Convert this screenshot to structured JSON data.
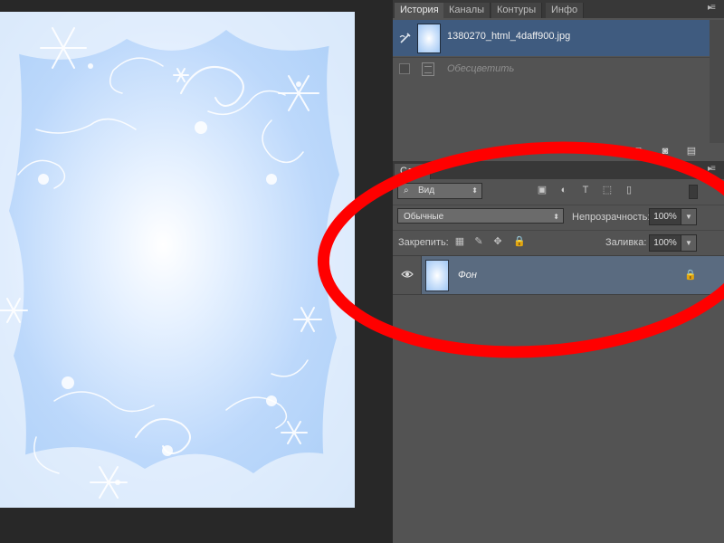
{
  "colors": {
    "panel_bg": "#535353",
    "tab_bar": "#383838",
    "selection": "#3f5b7f",
    "layer_selected": "#5a6b80",
    "annotation": "#ff0000"
  },
  "history_panel": {
    "tabs": [
      {
        "label": "История",
        "active": true
      },
      {
        "label": "Каналы",
        "active": false
      },
      {
        "label": "Контуры",
        "active": false
      },
      {
        "label": "Инфо",
        "active": false
      }
    ],
    "snapshot_name": "1380270_html_4daff900.jpg",
    "step_name": "Обесцветить",
    "bottom_icons": [
      "new-document-icon",
      "camera-icon",
      "trash-icon"
    ]
  },
  "layers_panel": {
    "tab_label": "Слои",
    "filter": {
      "label": "Вид",
      "icons": [
        "image-filter-icon",
        "adjustment-filter-icon",
        "type-filter-icon",
        "shape-filter-icon",
        "smart-object-filter-icon"
      ]
    },
    "blend_mode": "Обычные",
    "opacity_label": "Непрозрачность:",
    "opacity_value": "100%",
    "lock_label": "Закрепить:",
    "lock_icons": [
      "lock-transparent-icon",
      "lock-pixels-icon",
      "lock-position-icon",
      "lock-all-icon"
    ],
    "fill_label": "Заливка:",
    "fill_value": "100%",
    "layers": [
      {
        "name": "Фон",
        "visible": true,
        "locked": true
      }
    ]
  }
}
